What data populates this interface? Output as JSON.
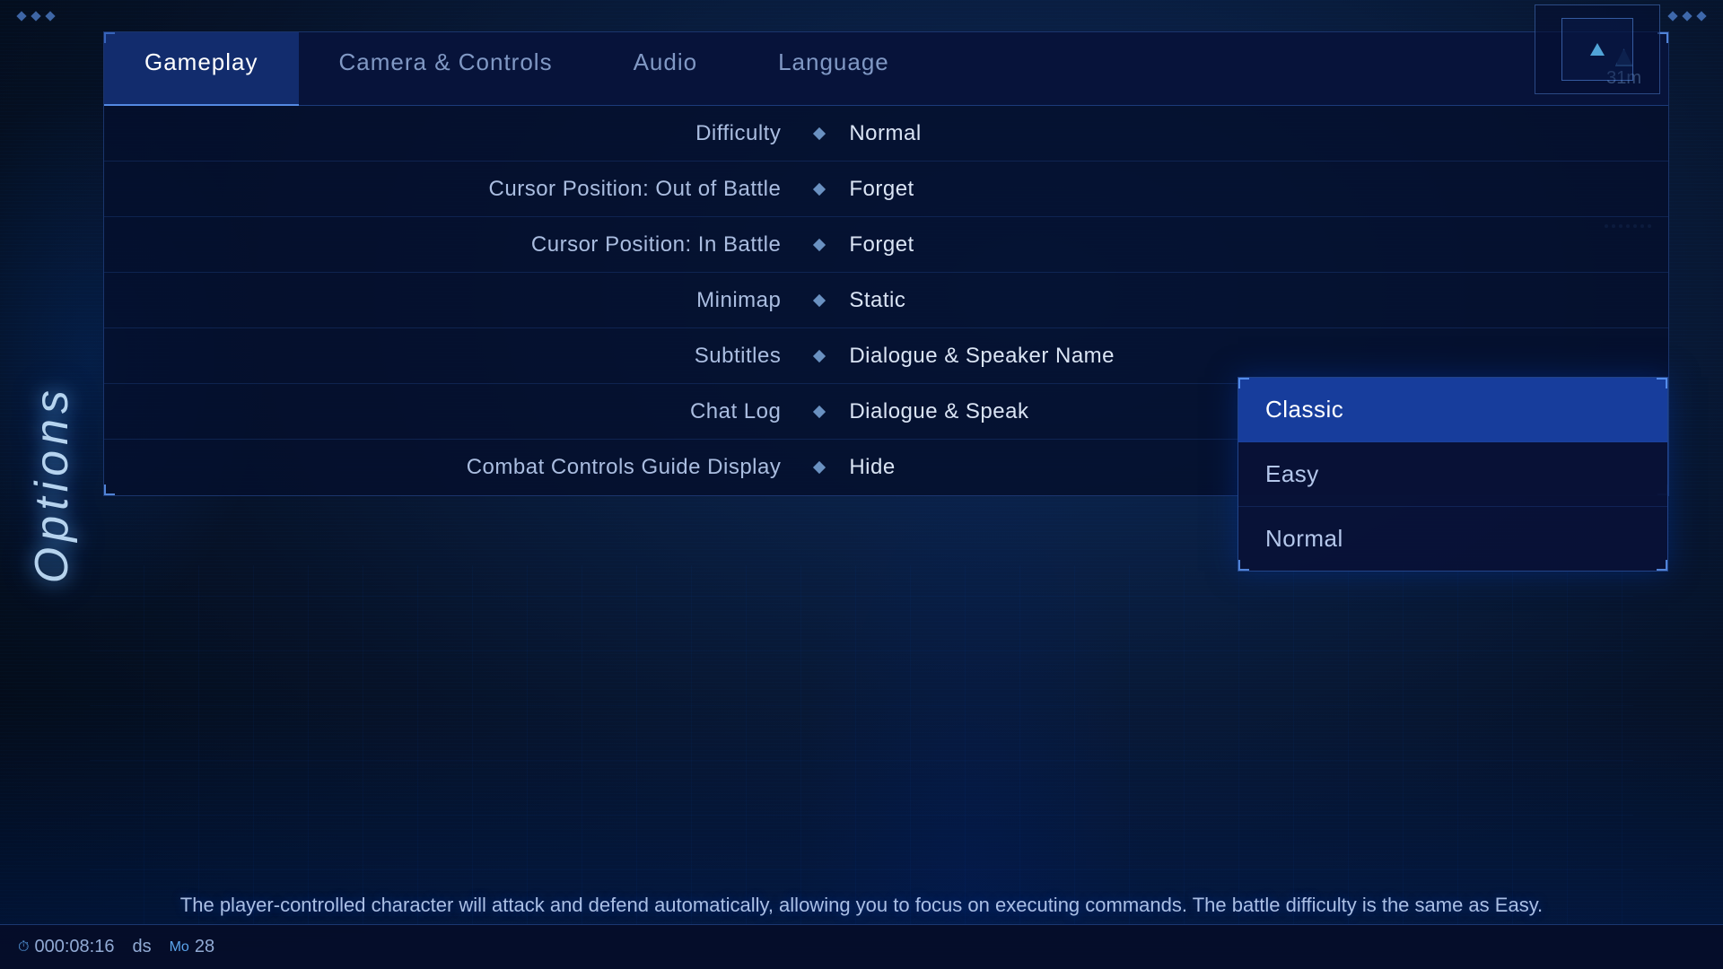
{
  "sidebar": {
    "label": "Options"
  },
  "nav": {
    "tabs": [
      {
        "id": "gameplay",
        "label": "Gameplay",
        "active": true
      },
      {
        "id": "camera",
        "label": "Camera & Controls",
        "active": false
      },
      {
        "id": "audio",
        "label": "Audio",
        "active": false
      },
      {
        "id": "language",
        "label": "Language",
        "active": false
      }
    ],
    "timer": "31m"
  },
  "settings": [
    {
      "id": "difficulty",
      "label": "Difficulty",
      "value": "Normal"
    },
    {
      "id": "cursor-out-battle",
      "label": "Cursor Position: Out of Battle",
      "value": "Forget"
    },
    {
      "id": "cursor-in-battle",
      "label": "Cursor Position: In Battle",
      "value": "Forget"
    },
    {
      "id": "minimap",
      "label": "Minimap",
      "value": "Static"
    },
    {
      "id": "subtitles",
      "label": "Subtitles",
      "value": "Dialogue & Speaker Name"
    },
    {
      "id": "chat-log",
      "label": "Chat Log",
      "value": "Dialogue & Speak"
    },
    {
      "id": "combat-guide",
      "label": "Combat Controls Guide Display",
      "value": "Hide"
    }
  ],
  "dropdown": {
    "visible": true,
    "for_setting": "chat-log",
    "options": [
      {
        "id": "classic",
        "label": "Classic",
        "selected": true
      },
      {
        "id": "easy",
        "label": "Easy",
        "selected": false
      },
      {
        "id": "normal",
        "label": "Normal",
        "selected": false
      }
    ]
  },
  "hint_text": "The player-controlled character will attack and defend automatically, allowing you to focus on executing commands. The battle difficulty is the same as Easy.",
  "status_bar": {
    "timer_icon": "⏱",
    "timer_value": "000:08:16",
    "controller_label": "ds",
    "map_icon": "🗺",
    "map_value": "28"
  },
  "colors": {
    "accent": "#4a90e2",
    "selected_bg": "rgba(30,80,200,0.7)",
    "panel_bg": "rgba(5,15,45,0.85)"
  }
}
